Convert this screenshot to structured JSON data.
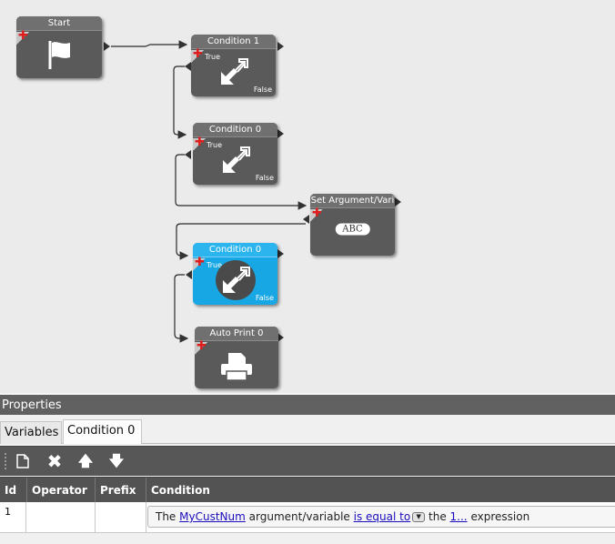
{
  "workflow": {
    "nodes": {
      "start": {
        "title": "Start",
        "icon": "flag-icon"
      },
      "condition1": {
        "title": "Condition 1",
        "true_label": "True",
        "false_label": "False",
        "icon": "condition-arrows-icon"
      },
      "condition0a": {
        "title": "Condition 0",
        "true_label": "True",
        "false_label": "False",
        "icon": "condition-arrows-icon"
      },
      "set_argument": {
        "title": "Set Argument/Vari",
        "badge": "ABC"
      },
      "condition0b": {
        "title": "Condition 0",
        "true_label": "True",
        "false_label": "False",
        "icon": "condition-arrows-icon",
        "selected": true
      },
      "auto_print": {
        "title": "Auto Print 0",
        "icon": "printer-icon"
      }
    },
    "colors": {
      "node": "#5a5a5a",
      "selected": "#16a7e4",
      "plus": "#e01d1d"
    }
  },
  "properties": {
    "title": "Properties",
    "tabs": [
      "Variables",
      "Condition 0"
    ],
    "active_tab": "Condition 0",
    "toolbar": [
      "new-icon",
      "delete-icon",
      "move-up-icon",
      "move-down-icon"
    ],
    "columns": [
      "Id",
      "Operator",
      "Prefix",
      "Condition"
    ],
    "rows": [
      {
        "id": "1",
        "operator": "",
        "prefix": "",
        "condition": {
          "t1": "The",
          "variable": "MyCustNum",
          "t2": "argument/variable",
          "comparison": "is equal to",
          "t3": "the",
          "value": "1...",
          "t4": "expression"
        }
      }
    ]
  }
}
